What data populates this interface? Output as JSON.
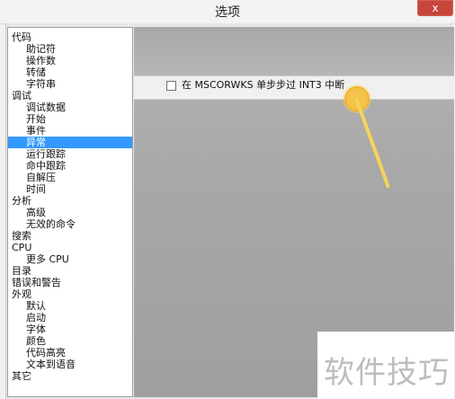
{
  "window": {
    "title": "选项",
    "close_label": "x"
  },
  "tree": {
    "items": [
      {
        "label": "代码",
        "level": 0
      },
      {
        "label": "助记符",
        "level": 1
      },
      {
        "label": "操作数",
        "level": 1
      },
      {
        "label": "转储",
        "level": 1
      },
      {
        "label": "字符串",
        "level": 1
      },
      {
        "label": "调试",
        "level": 0
      },
      {
        "label": "调试数据",
        "level": 1
      },
      {
        "label": "开始",
        "level": 1
      },
      {
        "label": "事件",
        "level": 1
      },
      {
        "label": "异常",
        "level": 1,
        "selected": true
      },
      {
        "label": "运行跟踪",
        "level": 1
      },
      {
        "label": "命中跟踪",
        "level": 1
      },
      {
        "label": "自解压",
        "level": 1
      },
      {
        "label": "时间",
        "level": 1
      },
      {
        "label": "分析",
        "level": 0
      },
      {
        "label": "高级",
        "level": 1
      },
      {
        "label": "无效的命令",
        "level": 1
      },
      {
        "label": "搜索",
        "level": 0
      },
      {
        "label": "CPU",
        "level": 0
      },
      {
        "label": "更多 CPU",
        "level": 1
      },
      {
        "label": "目录",
        "level": 0
      },
      {
        "label": "错误和警告",
        "level": 0
      },
      {
        "label": "外观",
        "level": 0
      },
      {
        "label": "默认",
        "level": 1
      },
      {
        "label": "启动",
        "level": 1
      },
      {
        "label": "字体",
        "level": 1
      },
      {
        "label": "颜色",
        "level": 1
      },
      {
        "label": "代码高亮",
        "level": 1
      },
      {
        "label": "文本到语音",
        "level": 1
      },
      {
        "label": "其它",
        "level": 0
      }
    ]
  },
  "option": {
    "checkbox_label": "在 MSCORWKS 单步步过 INT3 中断",
    "checked": false
  },
  "watermark": {
    "text": "软件技巧"
  }
}
